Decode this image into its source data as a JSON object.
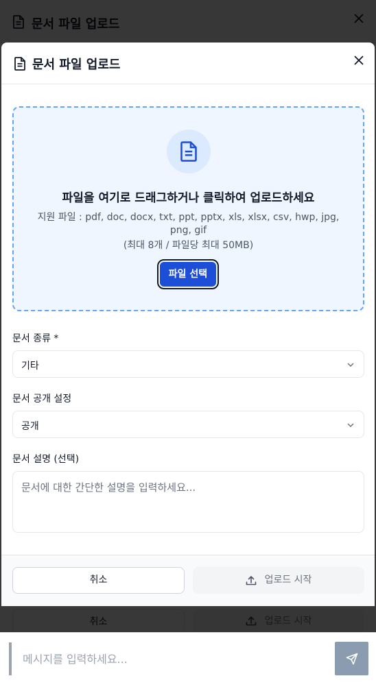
{
  "modal": {
    "title": "문서 파일 업로드",
    "close_icon": "close-icon"
  },
  "dropzone": {
    "icon": "document-icon",
    "title": "파일을 여기로 드래그하거나 클릭하여 업로드하세요",
    "supported_types": "지원 파일 : pdf, doc, docx, txt, ppt, pptx, xls, xlsx, csv, hwp, jpg, png, gif",
    "limit": "(최대 8개 / 파일당 최대 50MB)",
    "select_button": "파일 선택"
  },
  "form": {
    "doc_type": {
      "label": "문서 종류 *",
      "value": "기타"
    },
    "visibility": {
      "label": "문서 공개 설정",
      "value": "공개"
    },
    "description": {
      "label": "문서 설명 (선택)",
      "placeholder": "문서에 대한 간단한 설명을 입력하세요..."
    }
  },
  "footer": {
    "cancel": "취소",
    "upload": "업로드 시작",
    "upload_icon": "upload-icon"
  },
  "chat": {
    "placeholder": "메시지를 입력하세요...",
    "send_icon": "send-icon"
  },
  "colors": {
    "accent": "#1d4ed8",
    "dropzone_border": "#60a5fa",
    "dropzone_bg": "#eff6ff"
  }
}
